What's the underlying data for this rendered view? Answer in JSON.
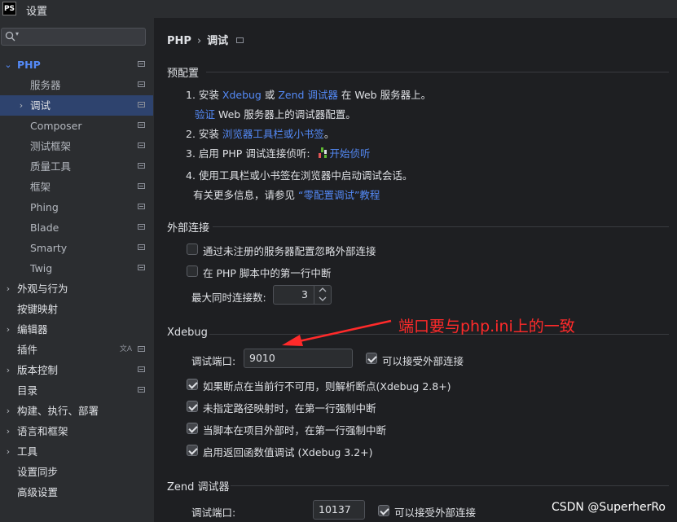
{
  "titlebar": {
    "app_icon": "PS",
    "title": "设置"
  },
  "search": {
    "placeholder": ""
  },
  "sidebar": {
    "items": [
      {
        "label": "PHP",
        "arrow": "⌄",
        "level": 0,
        "selected": false,
        "accent": true,
        "project_icon": true
      },
      {
        "label": "服务器",
        "level": 1,
        "project_icon": true
      },
      {
        "label": "调试",
        "arrow": "›",
        "level": 1,
        "selected": true,
        "project_icon": true
      },
      {
        "label": "Composer",
        "level": 1,
        "project_icon": true
      },
      {
        "label": "测试框架",
        "level": 1,
        "project_icon": true
      },
      {
        "label": "质量工具",
        "level": 1,
        "project_icon": true
      },
      {
        "label": "框架",
        "level": 1,
        "project_icon": true
      },
      {
        "label": "Phing",
        "level": 1,
        "project_icon": true
      },
      {
        "label": "Blade",
        "level": 1,
        "project_icon": true
      },
      {
        "label": "Smarty",
        "level": 1,
        "project_icon": true
      },
      {
        "label": "Twig",
        "level": 1,
        "project_icon": true
      },
      {
        "label": "外观与行为",
        "arrow": "›",
        "level": 0
      },
      {
        "label": "按键映射",
        "level": 0
      },
      {
        "label": "编辑器",
        "arrow": "›",
        "level": 0
      },
      {
        "label": "插件",
        "level": 0,
        "project_icon": true,
        "translate_icon": true
      },
      {
        "label": "版本控制",
        "arrow": "›",
        "level": 0,
        "project_icon": true
      },
      {
        "label": "目录",
        "level": 0,
        "project_icon": true
      },
      {
        "label": "构建、执行、部署",
        "arrow": "›",
        "level": 0
      },
      {
        "label": "语言和框架",
        "arrow": "›",
        "level": 0
      },
      {
        "label": "工具",
        "arrow": "›",
        "level": 0
      },
      {
        "label": "设置同步",
        "level": 0
      },
      {
        "label": "高级设置",
        "level": 0
      }
    ]
  },
  "breadcrumb": {
    "root": "PHP",
    "sep": "›",
    "current": "调试"
  },
  "pre": {
    "title": "预配置",
    "step1_a": "1. 安装 ",
    "step1_xdebug": "Xdebug",
    "step1_or": " 或 ",
    "step1_zend": "Zend 调试器",
    "step1_b": " 在 Web 服务器上。",
    "verify_link": "验证",
    "verify_text": " Web 服务器上的调试器配置。",
    "step2_a": "2. 安装 ",
    "step2_link": "浏览器工具栏或小书签",
    "step2_b": "。",
    "step3_a": "3. 启用 PHP 调试连接侦听: ",
    "step3_link": "开始侦听",
    "step4": "4. 使用工具栏或小书签在浏览器中启动调试会话。",
    "more_a": "有关更多信息，请参见 ",
    "more_link": "“零配置调试”教程"
  },
  "external": {
    "title": "外部连接",
    "cb1": "通过未注册的服务器配置忽略外部连接",
    "cb2": "在 PHP 脚本中的第一行中断",
    "max_label": "最大同时连接数:",
    "max_value": "3"
  },
  "xdebug": {
    "title": "Xdebug",
    "port_label": "调试端口:",
    "port_value": "9010",
    "accept_label": "可以接受外部连接",
    "cb1": "如果断点在当前行不可用，则解析断点(Xdebug 2.8+)",
    "cb2": "未指定路径映射时，在第一行强制中断",
    "cb3": "当脚本在项目外部时，在第一行强制中断",
    "cb4": "启用返回函数值调试 (Xdebug 3.2+)"
  },
  "zend": {
    "title": "Zend 调试器",
    "port_label": "调试端口:",
    "port_value": "10137",
    "accept_label": "可以接受外部连接"
  },
  "annotation": "端口要与php.ini上的一致",
  "watermark": "CSDN @SuperherRo",
  "colors": {
    "accent": "#548af7",
    "selection": "#2e436e",
    "annotation": "#ff2a2a"
  }
}
